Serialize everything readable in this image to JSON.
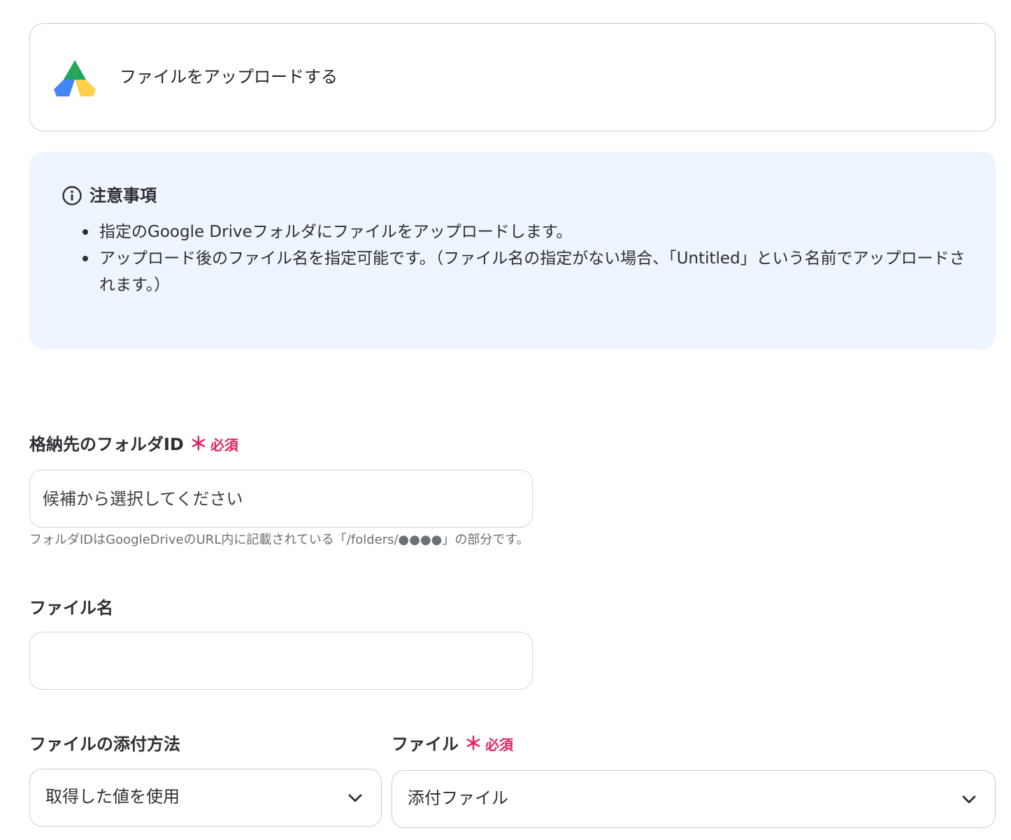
{
  "action": {
    "title": "ファイルをアップロードする",
    "app_icon": "google-drive-icon"
  },
  "notice": {
    "icon": "info-icon",
    "title": "注意事項",
    "items": [
      "指定のGoogle Driveフォルダにファイルをアップロードします。",
      "アップロード後のファイル名を指定可能です。（ファイル名の指定がない場合、「Untitled」という名前でアップロードされます。）"
    ]
  },
  "fields": {
    "folder_id": {
      "label": "格納先のフォルダID",
      "required_mark": "＊",
      "required_text": "必須",
      "placeholder": "候補から選択してください",
      "value": "",
      "hint": "フォルダIDはGoogleDriveのURL内に記載されている「/folders/●●●●」の部分です。"
    },
    "file_name": {
      "label": "ファイル名",
      "value": ""
    },
    "attach_method": {
      "label": "ファイルの添付方法",
      "selected": "取得した値を使用"
    },
    "file": {
      "label": "ファイル",
      "required_mark": "＊",
      "required_text": "必須",
      "selected": "添付ファイル"
    }
  },
  "colors": {
    "required": "#e0245e",
    "notice_bg": "#eef5fe",
    "border": "#c9cdd2"
  }
}
